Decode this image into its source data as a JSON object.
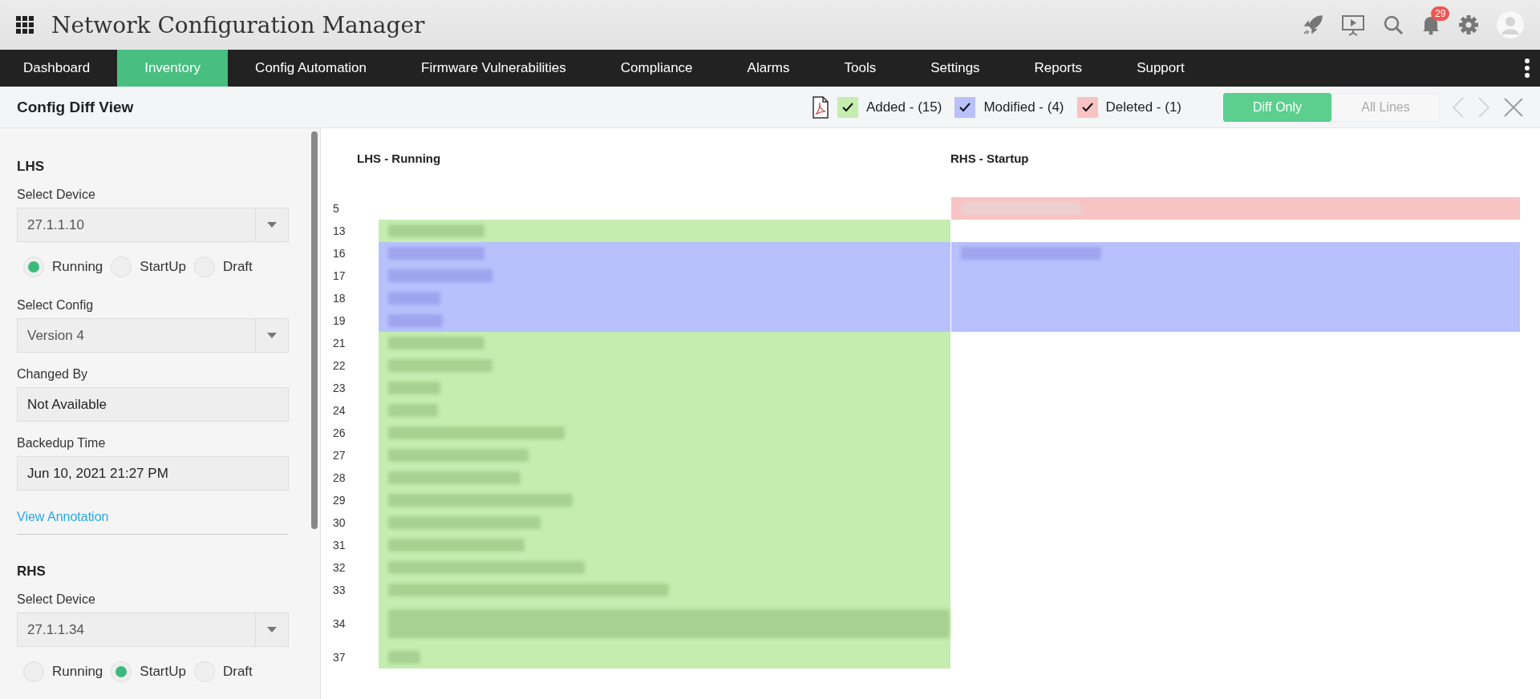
{
  "app": {
    "title": "Network Configuration Manager",
    "notification_count": "29"
  },
  "nav": [
    {
      "label": "Dashboard",
      "selected": false
    },
    {
      "label": "Inventory",
      "selected": true
    },
    {
      "label": "Config Automation",
      "selected": false
    },
    {
      "label": "Firmware Vulnerabilities",
      "selected": false
    },
    {
      "label": "Compliance",
      "selected": false
    },
    {
      "label": "Alarms",
      "selected": false
    },
    {
      "label": "Tools",
      "selected": false
    },
    {
      "label": "Settings",
      "selected": false
    },
    {
      "label": "Reports",
      "selected": false
    },
    {
      "label": "Support",
      "selected": false
    }
  ],
  "page": {
    "title": "Config Diff View"
  },
  "legend": [
    {
      "label": "Added - (15)",
      "color": "#c6edb0",
      "checked": true
    },
    {
      "label": "Modified - (4)",
      "color": "#b8c1fc",
      "checked": true
    },
    {
      "label": "Deleted - (1)",
      "color": "#f8c3c3",
      "checked": true
    }
  ],
  "view_toggle": [
    {
      "label": "Diff Only",
      "selected": true
    },
    {
      "label": "All Lines",
      "selected": false
    }
  ],
  "sidebar": {
    "sections": [
      {
        "heading": "LHS",
        "device_label": "Select Device",
        "device": "27.1.1.10",
        "types": [
          {
            "label": "Running",
            "selected": true
          },
          {
            "label": "StartUp",
            "selected": false
          },
          {
            "label": "Draft",
            "selected": false
          }
        ],
        "config_label": "Select Config",
        "config": "Version 4",
        "changed_by_label": "Changed By",
        "changed_by": "Not Available",
        "backup_label": "Backedup Time",
        "backup_time": "Jun 10, 2021 21:27 PM",
        "link": "View Annotation"
      },
      {
        "heading": "RHS",
        "device_label": "Select Device",
        "device": "27.1.1.34",
        "types": [
          {
            "label": "Running",
            "selected": false
          },
          {
            "label": "StartUp",
            "selected": true
          },
          {
            "label": "Draft",
            "selected": false
          }
        ]
      }
    ]
  },
  "diff": {
    "left_title": "LHS - Running",
    "right_title": "RHS - Startup",
    "rows": [
      {
        "line": "5",
        "kind": "deleted"
      },
      {
        "line": "13",
        "kind": "added"
      },
      {
        "line": "16",
        "kind": "modified",
        "right_text": true
      },
      {
        "line": "17",
        "kind": "modified",
        "right_text": false
      },
      {
        "line": "18",
        "kind": "modified",
        "right_text": false
      },
      {
        "line": "19",
        "kind": "modified",
        "right_text": false
      },
      {
        "line": "21",
        "kind": "added"
      },
      {
        "line": "22",
        "kind": "added"
      },
      {
        "line": "23",
        "kind": "added"
      },
      {
        "line": "24",
        "kind": "added"
      },
      {
        "line": "26",
        "kind": "added"
      },
      {
        "line": "27",
        "kind": "added"
      },
      {
        "line": "28",
        "kind": "added"
      },
      {
        "line": "29",
        "kind": "added"
      },
      {
        "line": "30",
        "kind": "added"
      },
      {
        "line": "31",
        "kind": "added"
      },
      {
        "line": "32",
        "kind": "added"
      },
      {
        "line": "33",
        "kind": "added"
      },
      {
        "line": "34",
        "kind": "added",
        "wrapped": true
      },
      {
        "line": "37",
        "kind": "added"
      }
    ]
  }
}
